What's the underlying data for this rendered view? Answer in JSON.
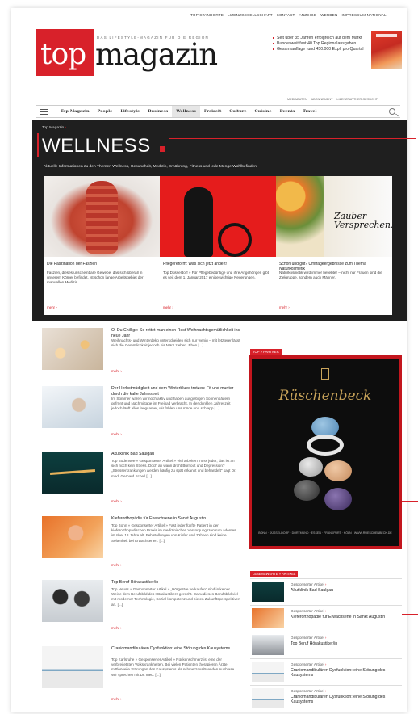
{
  "utility_nav": [
    "TOP STANDORTE",
    "LIZENZGESELLSCHAFT",
    "KONTAKT",
    "ANZEIGE",
    "WERBEN",
    "IMPRESSUM NATIONAL"
  ],
  "brand": {
    "logo_top": "top",
    "logo_magazin": "magazin",
    "slogan": "DAS LIFESTYLE-MAGAZIN FÜR DIE REGION"
  },
  "facts": [
    "Seit über 35 Jahren erfolgreich auf dem Markt",
    "Bundesweit fast 40 Top Regionalausgaben",
    "Gesamtauflage rund 450.000 Expl. pro Quartal"
  ],
  "sub_nav": [
    "MEDIADATEN",
    "ABONNEMENT",
    "LIZENZPARTNER GESUCHT"
  ],
  "main_nav": [
    "Top Magazin",
    "People",
    "Lifestyle",
    "Business",
    "Wellness",
    "Freizeit",
    "Culture",
    "Cuisine",
    "Events",
    "Travel"
  ],
  "main_nav_active": "Wellness",
  "section": {
    "breadcrumb": "Top Magazin",
    "breadcrumb_sep": "›",
    "title": "WELLNESS",
    "description": "Aktuelle Informationen zu den Themen Wellness, Gesundheit, Medizin, Ernährung, Fitness und jede Menge Wohlbefinden."
  },
  "featured": [
    {
      "title": "Die Faszination der Faszien",
      "text": "Faszien, dieses unscheinbare Gewebe, das sich überall in unserem Körper befindet, ist schon lange Arbeitsgebiet der manuellen Medizin.",
      "more": "mehr ›",
      "image": "muscle-anatomy"
    },
    {
      "title": "Pflegereform: Was sich jetzt ändert!",
      "text": "Top Düsseldorf » Für Pflegebedürftige und ihre Angehörigen gibt es seit dem 1. Januar 2017 einige wichtige Neuerungen.",
      "more": "mehr ›",
      "image": "care-silhouette"
    },
    {
      "title": "Schön und gut? Umfrageergebnisse zum Thema Naturkosmetik",
      "text": "Naturkosmetik wird immer beliebter – nicht nur Frauen sind die Zielgruppe, sondern auch Männer.",
      "more": "mehr ›",
      "image": "zauber",
      "image_text_1": "Zauber",
      "image_text_2": "Versprechen."
    }
  ],
  "articles": [
    {
      "title": "O, Du Chillige: So rettet man einen Rest Weihnachtsgemütlichkeit ins neue Jahr",
      "text": "Weihnachts- und Winterdeko unterscheiden sich nur wenig – mit letzterer lässt sich die Gemütlichkeit jedoch bis März ziehen.   Eben [...]",
      "more": "mehr ›"
    },
    {
      "title": "Der Herbstmüdigkeit und dem Winterblues trotzen: Fit und munter durch die kalte Jahreszeit",
      "text": "Im Sommer waren wir noch aktiv und haben ausgiebigen Sonnenbädern gefrönt und Nachmittage im Freibad verbracht. In der dunklen Jahreszeit jedoch läuft alles langsamer, wir fühlen uns müde und schlapp [...]",
      "more": "mehr ›"
    },
    {
      "title": "Akutklinik Bad Saulgau",
      "text": "Top Bodensee » Gesponserter Artikel » Viel arbeiten muss jeder; das ist an sich noch kein Stress. Doch ab wann droht Burnout und Depression? „Stresserkrankungen werden häufig zu spät erkannt und behandelt\" sagt Dr. med. Gerhard Schell [...]",
      "more": "mehr ›"
    },
    {
      "title": "Kieferorthopädie für Erwachsene in Sankt Augustin",
      "text": "Top Bonn » Gesponserter Artikel » Fast jeder fünfte Patient in der kieferorthopädischen Praxis im medizinischen Versorgungszentrum adentes ist über 18 Jahre alt. Fehlstellungen von Kiefer und Zähnen sind keine Seltenheit bei Erwachsenen. [...]",
      "more": "mehr ›"
    },
    {
      "title": "Top Beruf Hörakustiker/in",
      "text": "Top Neuss » Gesponserter Artikel » „Hörgeräte verkaufen\" sind in keiner Weise dem Berufsbild des Hörakustikers gerecht. Dazu dieses Berufsbild viel mit moderner Technologie, Sozial-kompetenz und bieten Zukunftsperspektiven an. [...]",
      "more": "mehr ›"
    },
    {
      "title": "Craniomandibulären Dysfunktion: eine Störung des Kausystems",
      "text": "Top Karlsruhe » Gesponserter Artikel » Rückenschmerz ist eine der verbreitetsten Volkskrankheiten. Bei vielen Patienten therapieren Ärzte mittlerweile Störungen des Kausystems als schmerzauslösenden Ausblase. Wir sprechen mit Dr. med. [...]",
      "more": "mehr ›"
    }
  ],
  "ad": {
    "label": "TOP » PARTNER",
    "brand": "Rüschenbeck",
    "footer": "BONN · DÜSSELDORF · DORTMUND · ESSEN · FRANKFURT · KÖLN · WWW.RUESCHENBECK.DE"
  },
  "sponsored": {
    "label": "LESENSWERTE » ARTIKEL",
    "kicker": "Gesponserter Artikel",
    "items": [
      {
        "title": "Akutklinik Bad Saulgau"
      },
      {
        "title": "Kieferorthopädie für Erwachsene in Sankt Augustin"
      },
      {
        "title": "Top Beruf Hörakustiker/in"
      },
      {
        "title": "Craniomandibulären Dysfunktion: eine Störung des Kausystems"
      },
      {
        "title": "Craniomandibulären Dysfunktion: eine Störung des Kausystems"
      }
    ]
  },
  "colors": {
    "accent": "#d8212a",
    "dark_panel": "#1f1f1f"
  }
}
